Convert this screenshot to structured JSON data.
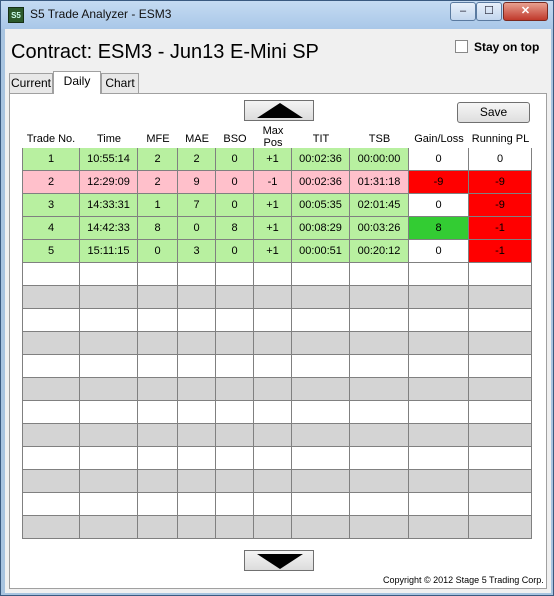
{
  "window": {
    "title": "S5 Trade Analyzer - ESM3",
    "icon_text": "S5"
  },
  "window_controls": {
    "minimize": "–",
    "maximize": "☐",
    "close": "✕"
  },
  "header": {
    "contract": "Contract: ESM3 - Jun13 E-Mini SP",
    "stay_on_top_label": "Stay on top",
    "stay_on_top_checked": false
  },
  "tabs": [
    {
      "label": "Current",
      "active": false
    },
    {
      "label": "Daily",
      "active": true
    },
    {
      "label": "Chart",
      "active": false
    }
  ],
  "toolbar": {
    "save_label": "Save"
  },
  "table": {
    "columns": [
      "Trade No.",
      "Time",
      "MFE",
      "MAE",
      "BSO",
      "Max Pos",
      "TIT",
      "TSB",
      "Gain/Loss",
      "Running PL"
    ],
    "rows": [
      {
        "cells": [
          "1",
          "10:55:14",
          "2",
          "2",
          "0",
          "+1",
          "00:02:36",
          "00:00:00",
          "0",
          "0"
        ],
        "status": "win",
        "gain_color": "white",
        "pl_color": "white"
      },
      {
        "cells": [
          "2",
          "12:29:09",
          "2",
          "9",
          "0",
          "-1",
          "00:02:36",
          "01:31:18",
          "-9",
          "-9"
        ],
        "status": "loss",
        "gain_color": "red",
        "pl_color": "red"
      },
      {
        "cells": [
          "3",
          "14:33:31",
          "1",
          "7",
          "0",
          "+1",
          "00:05:35",
          "02:01:45",
          "0",
          "-9"
        ],
        "status": "win",
        "gain_color": "white",
        "pl_color": "red"
      },
      {
        "cells": [
          "4",
          "14:42:33",
          "8",
          "0",
          "8",
          "+1",
          "00:08:29",
          "00:03:26",
          "8",
          "-1"
        ],
        "status": "win",
        "gain_color": "green",
        "pl_color": "red"
      },
      {
        "cells": [
          "5",
          "15:11:15",
          "0",
          "3",
          "0",
          "+1",
          "00:00:51",
          "00:20:12",
          "0",
          "-1"
        ],
        "status": "win",
        "gain_color": "white",
        "pl_color": "red"
      }
    ],
    "empty_rows": 12
  },
  "colors": {
    "win": "#b8f0a0",
    "loss": "#ffc0cb",
    "red": "#ff0000",
    "green": "#33cc33",
    "white": "#ffffff",
    "gray": "#d4d4d4"
  },
  "icons": {
    "scroll_up": "triangle-up-icon",
    "scroll_down": "triangle-down-icon"
  },
  "footer": {
    "copyright": "Copyright © 2012 Stage 5 Trading Corp."
  }
}
